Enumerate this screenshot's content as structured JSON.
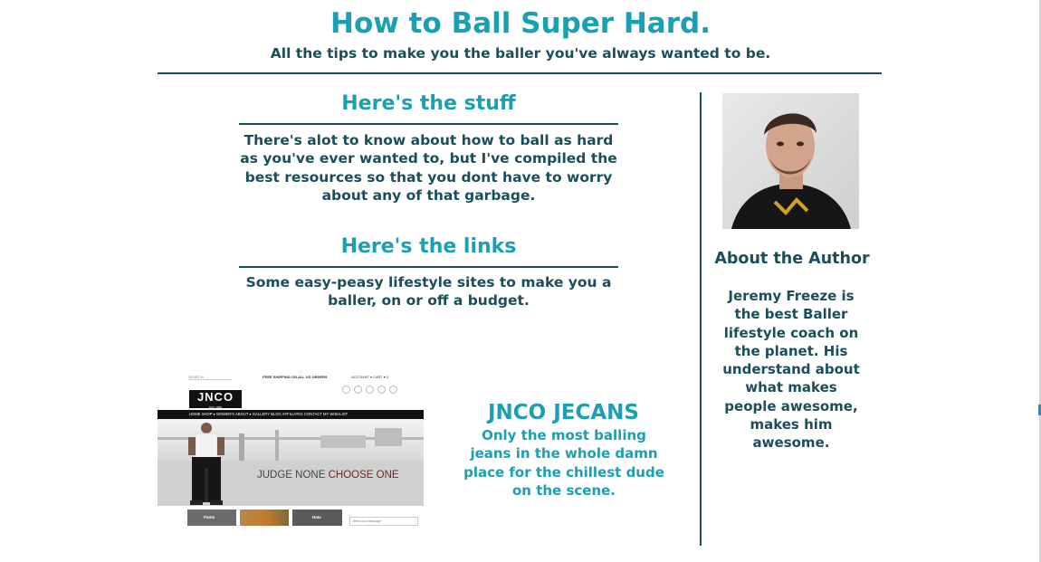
{
  "header": {
    "title": "How to Ball Super Hard.",
    "subtitle": "All the tips to make you the baller you've always wanted to be."
  },
  "sections": [
    {
      "heading": "Here's the stuff",
      "body": "There's alot to know about how to ball as hard as you've ever wanted to, but I've compiled the best resources so that you dont have to worry about any of that garbage."
    },
    {
      "heading": "Here's the links",
      "body": "Some easy-peasy lifestyle sites to make you a baller, on or off a budget."
    }
  ],
  "link_card": {
    "title": "JNCO JECANS",
    "description": "Only the most balling jeans in the whole damn place for the chillest dude on the scene.",
    "screenshot": {
      "search": "SEARCH",
      "shipping": "FREE SHIPPING ON ALL US ORDERS",
      "account": "ACCOUNT  ▾   CART  ▾ 0",
      "logo": "JNCO",
      "logo_sub": "EST. 1985",
      "nav": "HOME   SHOP ▾   WOMEN'S   ABOUT ▾   GALLERY   BLOG   AFFILIATES   CONTACT   MY WISHLIST",
      "hero_text_1": "JUDGE NONE",
      "hero_text_2": "CHOOSE ONE",
      "thumb_1": "Pants",
      "thumb_3": "Hats",
      "chat": "Send us a message"
    }
  },
  "author": {
    "heading": "About the Author",
    "bio": "Jeremy Freeze is the best Baller lifestyle coach on the planet. His understand about what makes people awesome, makes him awesome."
  },
  "colors": {
    "accent": "#1b9fb3",
    "dark_text": "#1a4f5a"
  }
}
